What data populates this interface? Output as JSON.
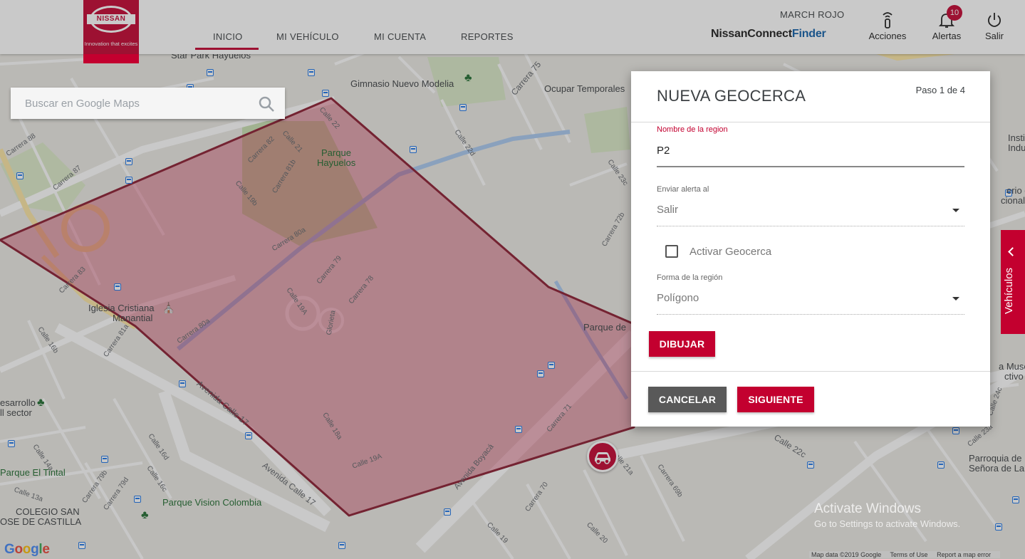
{
  "header": {
    "brand_name": "NISSAN",
    "brand_tagline": "Innovation that excites",
    "nav": [
      {
        "label": "INICIO"
      },
      {
        "label": "MI VEHÍCULO"
      },
      {
        "label": "MI CUENTA"
      },
      {
        "label": "REPORTES"
      }
    ],
    "user_name": "MARCH ROJO",
    "product_logo_main": "NissanConnect",
    "product_logo_sub": "Finder",
    "actions_label": "Acciones",
    "alerts_label": "Alertas",
    "alerts_count": "10",
    "logout_label": "Salir"
  },
  "map": {
    "search_placeholder": "Buscar en Google Maps",
    "pois": {
      "gym": "Gimnasio Nuevo Modelia",
      "park_hayuelos_1": "Parque",
      "park_hayuelos_2": "Hayuelos",
      "church_1": "Iglesia Cristiana",
      "church_2": "Manantial",
      "ocupar": "Ocupar Temporales",
      "parque_de": "Parque de",
      "parque_tintal": "Parque El Tintal",
      "parque_vision": "Parque Vision Colombia",
      "colegio_1": "COLEGIO SAN",
      "colegio_2": "OSE DE CASTILLA",
      "desarrollo_1": "esarrollo",
      "desarrollo_2": "ll sector",
      "parroquia_1": "Parroquia de",
      "parroquia_2": "Señora de La",
      "museo_1": "a Museo",
      "museo_2": "ctivo",
      "inst_1": "Insti",
      "inst_2": "Indu",
      "ericio_1": "erio de",
      "ericio_2": "cional",
      "hayuelos_top": "Star Park Hayuelos"
    },
    "streets": {
      "av_calle_17": "Avenida Calle 17",
      "av_calle_17b": "Avenida Calle 17",
      "av_boyaca": "Avenida Boyacá",
      "calle_22c": "Calle 22c",
      "carrera_80a": "Carrera 80a",
      "carrera_80a2": "Carrera 80a",
      "carrera_81b": "Carrera 81b",
      "carrera_82": "Carrera 82",
      "calle_21": "Calle 21",
      "calle_22": "Calle 22",
      "calle_19b": "Calle 19b",
      "carrera_79": "Carrera 79",
      "carrera_78": "Carrera 78",
      "calle_19a": "Calle 19A",
      "glorieta": "Glorieta",
      "carrera_83": "Carrera 83",
      "carrera_81a": "Carrera 81a",
      "carrera_88": "Carrera 88",
      "carrera_87": "Carrera 87",
      "calle_18a": "Calle 18a",
      "calle_19a2": "Calle 19A",
      "carrera_71": "Carrera 71",
      "carrera_70": "Carrera 70",
      "calle_21a": "Calle 21a",
      "carrera_69b": "Carrera 69b",
      "calle_23c": "Calle 23c",
      "calle_22d": "Calle 22d",
      "calle_24c": "Calle 24c",
      "carrera_72b": "Carrera 72b",
      "carrera_75": "Carrera 75",
      "calle_23a": "Calle 23a",
      "calle_19": "Calle 19",
      "calle_20": "Calle 20",
      "calle_14a": "Calle 14a",
      "calle_16b": "Calle 16b",
      "calle_16c": "Calle 16c",
      "calle_16d": "Calle 16d",
      "carrera_79b": "Carrera 79b",
      "carrera_79d": "Carrera 79d",
      "calle_13a": "Calle 13a"
    },
    "watermark_line1": "Activate Windows",
    "watermark_line2": "Go to Settings to activate Windows.",
    "google_logo": "Google",
    "footer": [
      "Map data ©2019 Google",
      "Terms of Use",
      "Report a map error"
    ]
  },
  "dialog": {
    "title": "NUEVA GEOCERCA",
    "step": "Paso 1 de 4",
    "region_name_label": "Nombre de la region",
    "region_name_value": "P2",
    "alert_label": "Enviar alerta al",
    "alert_value": "Salir",
    "activate_label": "Activar Geocerca",
    "activate_checked": false,
    "shape_label": "Forma de la región",
    "shape_value": "Polígono",
    "draw_button": "DIBUJAR",
    "cancel_button": "CANCELAR",
    "next_button": "SIGUIENTE"
  },
  "vehicles_tab": {
    "label": "Vehículos"
  },
  "colors": {
    "brand_red": "#c3002f",
    "geofence_fill": "#c3002f",
    "geofence_stroke": "#8a1a2e"
  }
}
